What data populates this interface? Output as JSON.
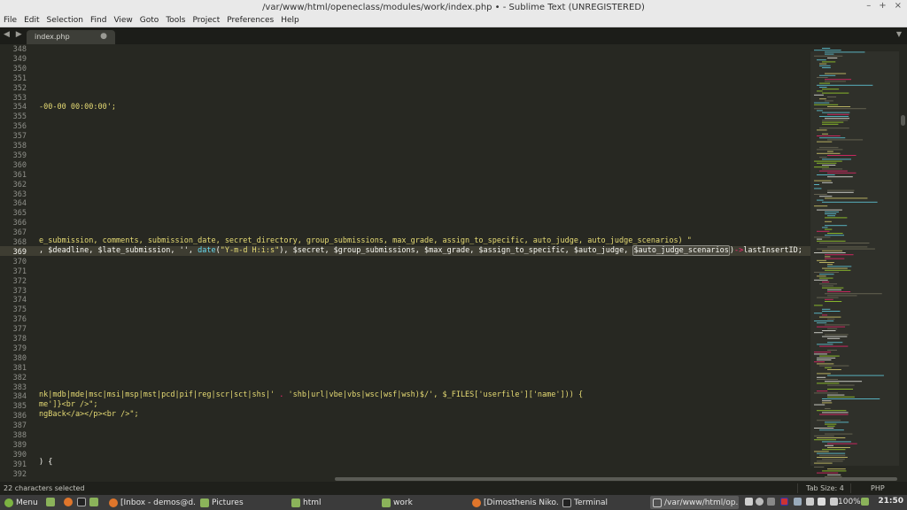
{
  "window": {
    "title": "/var/www/html/openeclass/modules/work/index.php • - Sublime Text (UNREGISTERED)",
    "controls": [
      "–",
      "+",
      "×"
    ]
  },
  "menu": [
    "File",
    "Edit",
    "Selection",
    "Find",
    "View",
    "Goto",
    "Tools",
    "Project",
    "Preferences",
    "Help"
  ],
  "tabbar": {
    "nav": "◀ ▶",
    "tab_label": "index.php",
    "tab_modified": "●",
    "menu_arrow": "▼"
  },
  "editor": {
    "line_numbers": [
      "348",
      "349",
      "350",
      "351",
      "352",
      "353",
      "354",
      "355",
      "356",
      "357",
      "358",
      "359",
      "360",
      "361",
      "362",
      "363",
      "364",
      "365",
      "366",
      "367",
      "368",
      "369",
      "370",
      "371",
      "372",
      "373",
      "374",
      "375",
      "376",
      "377",
      "378",
      "379",
      "380",
      "381",
      "382",
      "383",
      "384",
      "385",
      "386",
      "387",
      "388",
      "389",
      "390",
      "391",
      "392"
    ],
    "active_line": "369",
    "line_354": "-00-00 00:00:00';",
    "line_368": "e_submission, comments, submission_date, secret_directory, group_submissions, max_grade, assign_to_specific, auto_judge, auto_judge_scenarios) \"",
    "line_369": {
      "a": ", $deadline, $late_submission, '', ",
      "fn": "date",
      "b": "(",
      "str": "\"Y-m-d H:i:s\"",
      "c": "), $secret, $group_submissions, $max_grade, $assign_to_specific, $auto_judge, ",
      "selected": "$auto_judge_scenarios",
      "d": ")",
      "arrow": "->",
      "e": "lastInsertID;"
    },
    "line_384": {
      "a": "nk|mdb|mde|msc|msi|msp|mst|pcd|pif|reg|scr|sct|shs|' ",
      "dot": ".",
      "b": " 'shb|url|vbe|vbs|wsc|wsf|wsh)$/', $_FILES['userfile']['name'])) {"
    },
    "line_385": "me']}<br />\";",
    "line_386": "ngBack</a></p><br />\";",
    "line_391": ") {"
  },
  "status": {
    "selection": "22 characters selected",
    "tab_size": "Tab Size: 4",
    "syntax": "PHP"
  },
  "taskbar": {
    "menu": "Menu",
    "items": [
      "[Inbox - demos@d...",
      "Pictures",
      "html",
      "work",
      "[Dimosthenis Niko...",
      "Terminal",
      "/var/www/html/op..."
    ],
    "battery": "100%",
    "clock": "21:50"
  }
}
